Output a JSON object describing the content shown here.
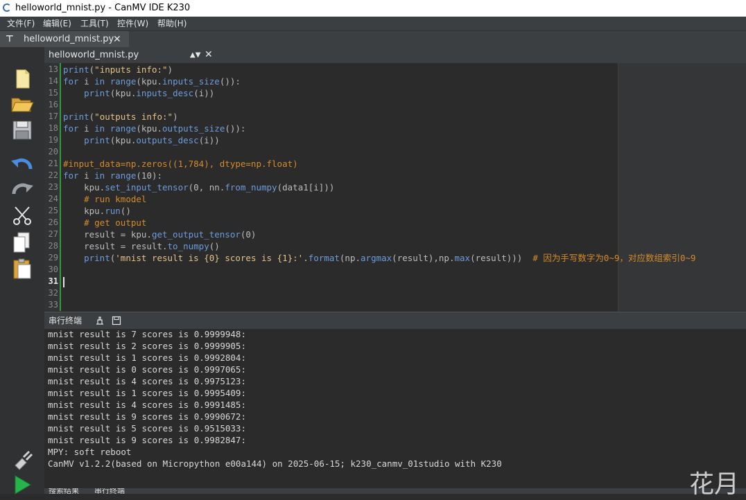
{
  "window": {
    "title": "helloworld_mnist.py - CanMV IDE K230"
  },
  "menu": [
    "文件(F)",
    "编辑(E)",
    "工具(T)",
    "控件(W)",
    "帮助(H)"
  ],
  "tab": {
    "label": "helloworld_mnist.py"
  },
  "editor": {
    "filename": "helloworld_mnist.py",
    "current_line": "31",
    "lines": [
      {
        "n": "13",
        "parts": [
          [
            "fn",
            "print"
          ],
          [
            "p",
            "("
          ],
          [
            "str",
            "\"inputs info:\""
          ],
          [
            "p",
            ")"
          ]
        ]
      },
      {
        "n": "14",
        "parts": [
          [
            "kw",
            "for"
          ],
          [
            "p",
            " i "
          ],
          [
            "kw",
            "in"
          ],
          [
            "p",
            " "
          ],
          [
            "fn",
            "range"
          ],
          [
            "p",
            "(kpu."
          ],
          [
            "fn",
            "inputs_size"
          ],
          [
            "p",
            "()):"
          ]
        ]
      },
      {
        "n": "15",
        "parts": [
          [
            "p",
            "    "
          ],
          [
            "fn",
            "print"
          ],
          [
            "p",
            "(kpu."
          ],
          [
            "fn",
            "inputs_desc"
          ],
          [
            "p",
            "(i))"
          ]
        ]
      },
      {
        "n": "16",
        "parts": []
      },
      {
        "n": "17",
        "parts": [
          [
            "fn",
            "print"
          ],
          [
            "p",
            "("
          ],
          [
            "str",
            "\"outputs info:\""
          ],
          [
            "p",
            ")"
          ]
        ]
      },
      {
        "n": "18",
        "parts": [
          [
            "kw",
            "for"
          ],
          [
            "p",
            " i "
          ],
          [
            "kw",
            "in"
          ],
          [
            "p",
            " "
          ],
          [
            "fn",
            "range"
          ],
          [
            "p",
            "(kpu."
          ],
          [
            "fn",
            "outputs_size"
          ],
          [
            "p",
            "()):"
          ]
        ]
      },
      {
        "n": "19",
        "parts": [
          [
            "p",
            "    "
          ],
          [
            "fn",
            "print"
          ],
          [
            "p",
            "(kpu."
          ],
          [
            "fn",
            "outputs_desc"
          ],
          [
            "p",
            "(i))"
          ]
        ]
      },
      {
        "n": "20",
        "parts": []
      },
      {
        "n": "21",
        "parts": [
          [
            "cm",
            "#input_data=np.zeros((1,784), dtype=np.float)"
          ]
        ]
      },
      {
        "n": "22",
        "parts": [
          [
            "kw",
            "for"
          ],
          [
            "p",
            " i "
          ],
          [
            "kw",
            "in"
          ],
          [
            "p",
            " "
          ],
          [
            "fn",
            "range"
          ],
          [
            "p",
            "(10):"
          ]
        ]
      },
      {
        "n": "23",
        "parts": [
          [
            "p",
            "    kpu."
          ],
          [
            "fn",
            "set_input_tensor"
          ],
          [
            "p",
            "(0, nn."
          ],
          [
            "fn",
            "from_numpy"
          ],
          [
            "p",
            "(data1[i]))"
          ]
        ]
      },
      {
        "n": "24",
        "parts": [
          [
            "p",
            "    "
          ],
          [
            "cm",
            "# run kmodel"
          ]
        ]
      },
      {
        "n": "25",
        "parts": [
          [
            "p",
            "    kpu."
          ],
          [
            "fn",
            "run"
          ],
          [
            "p",
            "()"
          ]
        ]
      },
      {
        "n": "26",
        "parts": [
          [
            "p",
            "    "
          ],
          [
            "cm",
            "# get output"
          ]
        ]
      },
      {
        "n": "27",
        "parts": [
          [
            "p",
            "    result = kpu."
          ],
          [
            "fn",
            "get_output_tensor"
          ],
          [
            "p",
            "(0)"
          ]
        ]
      },
      {
        "n": "28",
        "parts": [
          [
            "p",
            "    result = result."
          ],
          [
            "fn",
            "to_numpy"
          ],
          [
            "p",
            "()"
          ]
        ]
      },
      {
        "n": "29",
        "parts": [
          [
            "p",
            "    "
          ],
          [
            "fn",
            "print"
          ],
          [
            "p",
            "("
          ],
          [
            "str",
            "'mnist result is {0} scores is {1}:'"
          ],
          [
            "p",
            "."
          ],
          [
            "fn",
            "format"
          ],
          [
            "p",
            "(np."
          ],
          [
            "fn",
            "argmax"
          ],
          [
            "p",
            "(result),np."
          ],
          [
            "fn",
            "max"
          ],
          [
            "p",
            "(result)))  "
          ],
          [
            "cm",
            "# 因为手写数字为0~9，对应数组索引0~9"
          ]
        ]
      },
      {
        "n": "30",
        "parts": []
      },
      {
        "n": "31",
        "parts": []
      },
      {
        "n": "32",
        "parts": []
      },
      {
        "n": "33",
        "parts": []
      }
    ]
  },
  "terminal": {
    "title": "串行终端",
    "lines": [
      "mnist result is 7 scores is 0.9999948:",
      "mnist result is 2 scores is 0.9999905:",
      "mnist result is 1 scores is 0.9992804:",
      "mnist result is 0 scores is 0.9997065:",
      "mnist result is 4 scores is 0.9975123:",
      "mnist result is 1 scores is 0.9995409:",
      "mnist result is 4 scores is 0.9991485:",
      "mnist result is 9 scores is 0.9990672:",
      "mnist result is 5 scores is 0.9515033:",
      "mnist result is 9 scores is 0.9982847:",
      "MPY: soft reboot",
      "CanMV v1.2.2(based on Micropython e00a144) on 2025-06-15; k230_canmv_01studio with K230"
    ]
  },
  "bottom_tabs": [
    "搜索结果",
    "串行终端"
  ],
  "watermark": "花月",
  "colors": {
    "keyword": "#6d9cdc",
    "string": "#e6c28a",
    "comment": "#d48b2b",
    "fold": "#2e9d3a"
  },
  "sidebar_icons": [
    "new-file-icon",
    "open-folder-icon",
    "save-icon",
    "undo-icon",
    "redo-icon",
    "cut-icon",
    "copy-icon",
    "paste-icon",
    "connect-plug-icon",
    "run-icon"
  ]
}
